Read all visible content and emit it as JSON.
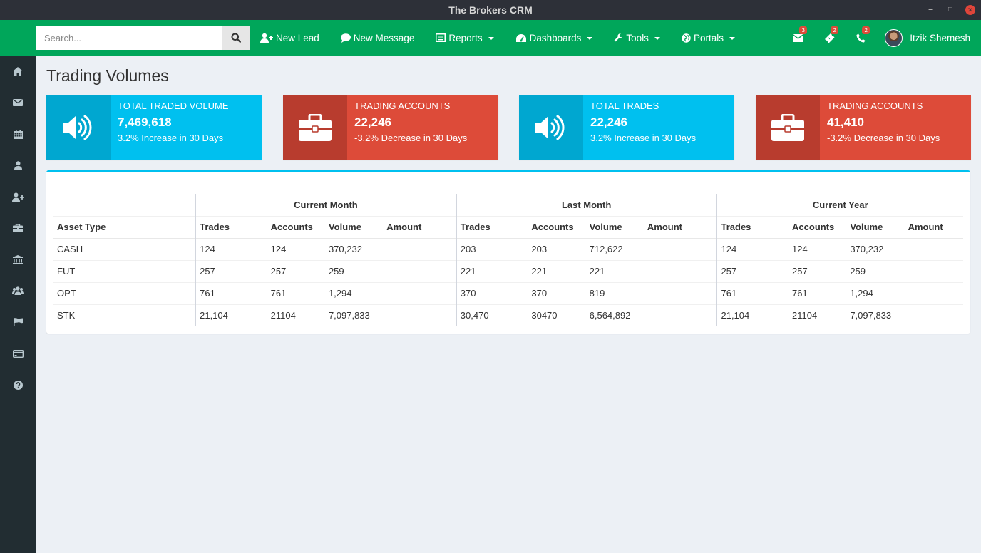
{
  "window": {
    "title": "The Brokers CRM"
  },
  "search": {
    "placeholder": "Search..."
  },
  "nav": {
    "items": [
      {
        "label": "New Lead",
        "icon": "user-plus-icon",
        "dropdown": false
      },
      {
        "label": "New Message",
        "icon": "comment-icon",
        "dropdown": false
      },
      {
        "label": "Reports",
        "icon": "list-alt-icon",
        "dropdown": true
      },
      {
        "label": "Dashboards",
        "icon": "dashboard-icon",
        "dropdown": true
      },
      {
        "label": "Tools",
        "icon": "wrench-icon",
        "dropdown": true
      },
      {
        "label": "Portals",
        "icon": "globe-icon",
        "dropdown": true
      }
    ],
    "notifications": {
      "messages": "3",
      "tickets": "2",
      "calls": "2"
    },
    "user_name": "Itzik Shemesh"
  },
  "sidebar": {
    "items": [
      "home-icon",
      "envelope-icon",
      "calendar-icon",
      "user-icon",
      "user-plus-icon",
      "briefcase-icon",
      "bank-icon",
      "users-icon",
      "flag-icon",
      "credit-card-icon",
      "question-circle-icon"
    ]
  },
  "page": {
    "title": "Trading Volumes"
  },
  "info_boxes": [
    {
      "label": "TOTAL TRADED VOLUME",
      "value": "7,469,618",
      "desc": "3.2% Increase in 30 Days",
      "color": "#00c0ef",
      "icon": "volume-icon"
    },
    {
      "label": "TRADING ACCOUNTS",
      "value": "22,246",
      "desc": "-3.2% Decrease in 30 Days",
      "color": "#dd4b39",
      "icon": "briefcase-icon"
    },
    {
      "label": "TOTAL TRADES",
      "value": "22,246",
      "desc": "3.2% Increase in 30 Days",
      "color": "#00c0ef",
      "icon": "volume-icon"
    },
    {
      "label": "TRADING ACCOUNTS",
      "value": "41,410",
      "desc": "-3.2% Decrease in 30 Days",
      "color": "#dd4b39",
      "icon": "briefcase-icon"
    }
  ],
  "table": {
    "groups": [
      "Current Month",
      "Last Month",
      "Current Year"
    ],
    "first_col": "Asset Type",
    "sub_cols": [
      "Trades",
      "Accounts",
      "Volume",
      "Amount"
    ],
    "rows": [
      {
        "asset": "CASH",
        "cm": [
          "124",
          "124",
          "370,232",
          ""
        ],
        "lm": [
          "203",
          "203",
          "712,622",
          ""
        ],
        "cy": [
          "124",
          "124",
          "370,232",
          ""
        ]
      },
      {
        "asset": "FUT",
        "cm": [
          "257",
          "257",
          "259",
          ""
        ],
        "lm": [
          "221",
          "221",
          "221",
          ""
        ],
        "cy": [
          "257",
          "257",
          "259",
          ""
        ]
      },
      {
        "asset": "OPT",
        "cm": [
          "761",
          "761",
          "1,294",
          ""
        ],
        "lm": [
          "370",
          "370",
          "819",
          ""
        ],
        "cy": [
          "761",
          "761",
          "1,294",
          ""
        ]
      },
      {
        "asset": "STK",
        "cm": [
          "21,104",
          "21104",
          "7,097,833",
          ""
        ],
        "lm": [
          "30,470",
          "30470",
          "6,564,892",
          ""
        ],
        "cy": [
          "21,104",
          "21104",
          "7,097,833",
          ""
        ]
      }
    ]
  }
}
